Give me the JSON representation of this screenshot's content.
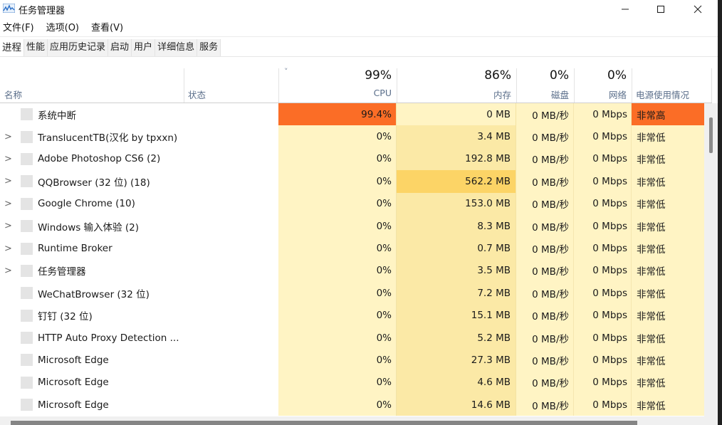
{
  "window": {
    "title": "任务管理器",
    "controls": {
      "minimize": "minimize",
      "maximize": "maximize",
      "close": "close"
    }
  },
  "menu": [
    "文件(F)",
    "选项(O)",
    "查看(V)"
  ],
  "tabs": [
    "进程",
    "性能",
    "应用历史记录",
    "启动",
    "用户",
    "详细信息",
    "服务"
  ],
  "active_tab": "进程",
  "columns": {
    "name": {
      "label": "名称"
    },
    "status": {
      "label": "状态"
    },
    "cpu": {
      "label": "CPU",
      "total": "99%"
    },
    "memory": {
      "label": "内存",
      "total": "86%"
    },
    "disk": {
      "label": "磁盘",
      "total": "0%"
    },
    "network": {
      "label": "网络",
      "total": "0%"
    },
    "power": {
      "label": "电源使用情况"
    }
  },
  "sort_indicator": "˅",
  "colors": {
    "hot": "#fb6d26",
    "light": "#fff4c4",
    "mid": "#fbe9a6",
    "strong": "#fcd466"
  },
  "processes": [
    {
      "name": "系统中断",
      "expandable": false,
      "cpu": "99.4%",
      "memory": "0 MB",
      "disk": "0 MB/秒",
      "network": "0 Mbps",
      "power": "非常高",
      "cpu_level": "hot",
      "mem_level": "light",
      "power_level": "hot"
    },
    {
      "name": "TranslucentTB(汉化 by tpxxn)",
      "expandable": true,
      "cpu": "0%",
      "memory": "3.4 MB",
      "disk": "0 MB/秒",
      "network": "0 Mbps",
      "power": "非常低",
      "cpu_level": "light",
      "mem_level": "mid",
      "power_level": "light"
    },
    {
      "name": "Adobe Photoshop CS6 (2)",
      "expandable": true,
      "cpu": "0%",
      "memory": "192.8 MB",
      "disk": "0 MB/秒",
      "network": "0 Mbps",
      "power": "非常低",
      "cpu_level": "light",
      "mem_level": "mid",
      "power_level": "light"
    },
    {
      "name": "QQBrowser (32 位) (18)",
      "expandable": true,
      "cpu": "0%",
      "memory": "562.2 MB",
      "disk": "0 MB/秒",
      "network": "0 Mbps",
      "power": "非常低",
      "cpu_level": "light",
      "mem_level": "strong",
      "power_level": "light"
    },
    {
      "name": "Google Chrome (10)",
      "expandable": true,
      "cpu": "0%",
      "memory": "153.0 MB",
      "disk": "0 MB/秒",
      "network": "0 Mbps",
      "power": "非常低",
      "cpu_level": "light",
      "mem_level": "mid",
      "power_level": "light"
    },
    {
      "name": "Windows 输入体验 (2)",
      "expandable": true,
      "cpu": "0%",
      "memory": "8.3 MB",
      "disk": "0 MB/秒",
      "network": "0 Mbps",
      "power": "非常低",
      "cpu_level": "light",
      "mem_level": "mid",
      "power_level": "light"
    },
    {
      "name": "Runtime Broker",
      "expandable": true,
      "cpu": "0%",
      "memory": "0.7 MB",
      "disk": "0 MB/秒",
      "network": "0 Mbps",
      "power": "非常低",
      "cpu_level": "light",
      "mem_level": "mid",
      "power_level": "light"
    },
    {
      "name": "任务管理器",
      "expandable": true,
      "cpu": "0%",
      "memory": "3.5 MB",
      "disk": "0 MB/秒",
      "network": "0 Mbps",
      "power": "非常低",
      "cpu_level": "light",
      "mem_level": "mid",
      "power_level": "light"
    },
    {
      "name": "WeChatBrowser (32 位)",
      "expandable": false,
      "cpu": "0%",
      "memory": "7.2 MB",
      "disk": "0 MB/秒",
      "network": "0 Mbps",
      "power": "非常低",
      "cpu_level": "light",
      "mem_level": "mid",
      "power_level": "light"
    },
    {
      "name": "钉钉 (32 位)",
      "expandable": false,
      "cpu": "0%",
      "memory": "15.1 MB",
      "disk": "0 MB/秒",
      "network": "0 Mbps",
      "power": "非常低",
      "cpu_level": "light",
      "mem_level": "mid",
      "power_level": "light"
    },
    {
      "name": "HTTP Auto Proxy Detection ...",
      "expandable": false,
      "cpu": "0%",
      "memory": "5.2 MB",
      "disk": "0 MB/秒",
      "network": "0 Mbps",
      "power": "非常低",
      "cpu_level": "light",
      "mem_level": "mid",
      "power_level": "light"
    },
    {
      "name": "Microsoft Edge",
      "expandable": false,
      "cpu": "0%",
      "memory": "27.3 MB",
      "disk": "0 MB/秒",
      "network": "0 Mbps",
      "power": "非常低",
      "cpu_level": "light",
      "mem_level": "mid",
      "power_level": "light"
    },
    {
      "name": "Microsoft Edge",
      "expandable": false,
      "cpu": "0%",
      "memory": "4.6 MB",
      "disk": "0 MB/秒",
      "network": "0 Mbps",
      "power": "非常低",
      "cpu_level": "light",
      "mem_level": "mid",
      "power_level": "light"
    },
    {
      "name": "Microsoft Edge",
      "expandable": false,
      "cpu": "0%",
      "memory": "14.6 MB",
      "disk": "0 MB/秒",
      "network": "0 Mbps",
      "power": "非常低",
      "cpu_level": "light",
      "mem_level": "mid",
      "power_level": "light"
    }
  ]
}
